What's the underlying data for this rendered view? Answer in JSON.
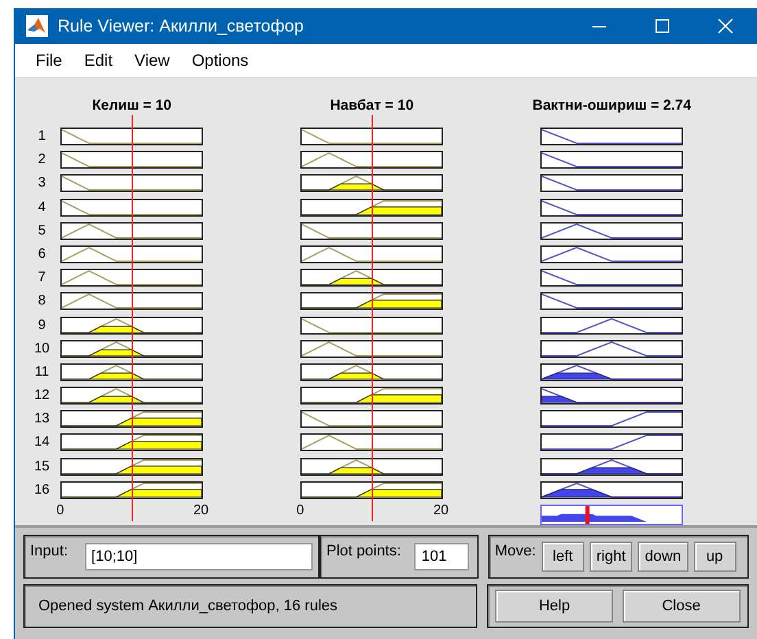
{
  "window": {
    "title": "Rule Viewer: Акилли_светофор"
  },
  "menu": [
    {
      "label": "File"
    },
    {
      "label": "Edit"
    },
    {
      "label": "View"
    },
    {
      "label": "Options"
    }
  ],
  "inputs": [
    {
      "title": "Келиш = 10",
      "axis": [
        "0",
        "20"
      ]
    },
    {
      "title": "Навбат = 10",
      "axis": [
        "0",
        "20"
      ]
    }
  ],
  "output": {
    "title": "Вактни-ошириш = 2.74"
  },
  "rules": [
    {
      "number": "1",
      "cells": [
        {
          "kind": "falling"
        },
        {
          "kind": "falling"
        },
        {
          "kind": "falling"
        }
      ]
    },
    {
      "number": "2",
      "cells": [
        {
          "kind": "falling"
        },
        {
          "kind": "peak-low"
        },
        {
          "kind": "falling"
        }
      ]
    },
    {
      "number": "3",
      "cells": [
        {
          "kind": "falling"
        },
        {
          "kind": "peak-mid"
        },
        {
          "kind": "falling"
        }
      ]
    },
    {
      "number": "4",
      "cells": [
        {
          "kind": "falling"
        },
        {
          "kind": "rising"
        },
        {
          "kind": "falling"
        }
      ]
    },
    {
      "number": "5",
      "cells": [
        {
          "kind": "peak-low"
        },
        {
          "kind": "falling"
        },
        {
          "kind": "peak-low"
        }
      ]
    },
    {
      "number": "6",
      "cells": [
        {
          "kind": "peak-low"
        },
        {
          "kind": "peak-low"
        },
        {
          "kind": "peak-low"
        }
      ]
    },
    {
      "number": "7",
      "cells": [
        {
          "kind": "peak-low"
        },
        {
          "kind": "peak-mid"
        },
        {
          "kind": "falling"
        }
      ]
    },
    {
      "number": "8",
      "cells": [
        {
          "kind": "peak-low"
        },
        {
          "kind": "rising"
        },
        {
          "kind": "falling"
        }
      ]
    },
    {
      "number": "9",
      "cells": [
        {
          "kind": "peak-mid"
        },
        {
          "kind": "falling"
        },
        {
          "kind": "peak-mid"
        }
      ]
    },
    {
      "number": "10",
      "cells": [
        {
          "kind": "peak-mid"
        },
        {
          "kind": "peak-low"
        },
        {
          "kind": "peak-mid"
        }
      ]
    },
    {
      "number": "11",
      "cells": [
        {
          "kind": "peak-mid"
        },
        {
          "kind": "peak-mid"
        },
        {
          "kind": "peak-low"
        }
      ]
    },
    {
      "number": "12",
      "cells": [
        {
          "kind": "peak-mid"
        },
        {
          "kind": "rising"
        },
        {
          "kind": "falling"
        }
      ]
    },
    {
      "number": "13",
      "cells": [
        {
          "kind": "rising"
        },
        {
          "kind": "falling"
        },
        {
          "kind": "rising"
        }
      ]
    },
    {
      "number": "14",
      "cells": [
        {
          "kind": "rising"
        },
        {
          "kind": "peak-low"
        },
        {
          "kind": "rising"
        }
      ]
    },
    {
      "number": "15",
      "cells": [
        {
          "kind": "rising"
        },
        {
          "kind": "peak-mid"
        },
        {
          "kind": "peak-mid"
        }
      ]
    },
    {
      "number": "16",
      "cells": [
        {
          "kind": "rising"
        },
        {
          "kind": "rising"
        },
        {
          "kind": "peak-low"
        }
      ]
    }
  ],
  "input_field": {
    "label": "Input:",
    "value": "[10;10]"
  },
  "plot_points": {
    "label": "Plot points:",
    "value": "101"
  },
  "move": {
    "label": "Move:",
    "buttons": [
      "left",
      "right",
      "down",
      "up"
    ]
  },
  "status": "Opened system Акилли_светофор, 16 rules",
  "buttons": [
    "Help",
    "Close"
  ]
}
